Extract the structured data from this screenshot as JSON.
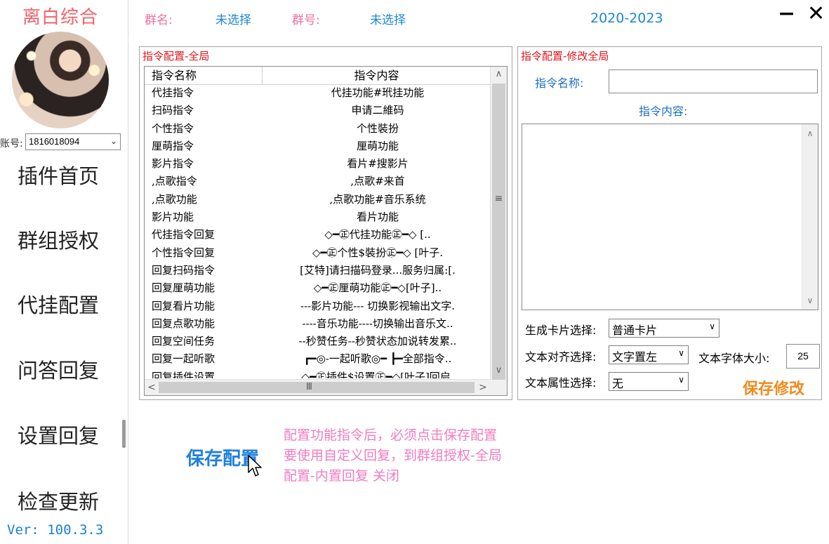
{
  "sidebar": {
    "title": "离白综合",
    "account_label": "账号:",
    "account_value": "1816018094",
    "nav": [
      "插件首页",
      "群组授权",
      "代挂配置",
      "问答回复",
      "设置回复",
      "检查更新"
    ],
    "version": "Ver:  100.3.3"
  },
  "header": {
    "group_name_label": "群名:",
    "group_name_value": "未选择",
    "group_id_label": "群号:",
    "group_id_value": "未选择",
    "year_range": "2020-2023",
    "minimize": "−",
    "close": "✕"
  },
  "command_panel": {
    "title": "指令配置-全局",
    "columns": [
      "指令名称",
      "指令内容"
    ],
    "rows": [
      {
        "name": "代挂指令",
        "content": "代挂功能#玳挂功能"
      },
      {
        "name": "扫码指令",
        "content": "申请二維码"
      },
      {
        "name": "个性指令",
        "content": "个性裝扮"
      },
      {
        "name": "厘萌指令",
        "content": "厘萌功能"
      },
      {
        "name": "影片指令",
        "content": "看片#搜影片"
      },
      {
        "name": ",点歌指令",
        "content": ",点歌#来首"
      },
      {
        "name": ",点歌功能",
        "content": ",点歌功能#音乐系统"
      },
      {
        "name": "影片功能",
        "content": "看片功能"
      },
      {
        "name": "代挂指令回复",
        "content": "◇━㊣代挂功能㊣━◇      [.."
      },
      {
        "name": "个性指令回复",
        "content": "◇━㊣个性$裝扮㊣━◇ [叶子."
      },
      {
        "name": "回复扫码指令",
        "content": "[艾特]请扫描码登录...服务归属:[."
      },
      {
        "name": "回复厘萌功能",
        "content": "◇━㊣厘萌功能㊣━◇[叶子].."
      },
      {
        "name": "回复看片功能",
        "content": "---影片功能--- 切换影视输出文字."
      },
      {
        "name": "回复点歌功能",
        "content": "----音乐功能----切换输出音乐文.."
      },
      {
        "name": "回复空间任务",
        "content": "--秒赞任务--秒赞状态加说转发累.."
      },
      {
        "name": "回复一起听歌",
        "content": "┏━◎-一起听歌◎━ ┣━全部指令.."
      },
      {
        "name": "回复插件设置",
        "content": "◇━㊣插件$设置㊣━◇[叶子]回启."
      }
    ]
  },
  "edit_panel": {
    "title": "指令配置-修改全局",
    "name_label": "指令名称:",
    "content_label": "指令内容:",
    "card_label": "生成卡片选择:",
    "card_value": "普通卡片",
    "align_label": "文本对齐选择:",
    "align_value": "文字置左",
    "font_size_label": "文本字体大小:",
    "font_size_value": "25",
    "attr_label": "文本属性选择:",
    "attr_value": "无",
    "save_button": "保存修改"
  },
  "bottom": {
    "save_config": "保存配置",
    "notice": [
      "配置功能指令后，必须点击保存配置",
      "要使用自定义回复，到群组授权-全局",
      "配置-内置回复 关闭"
    ]
  },
  "colors": {
    "title_red": "#f0626a",
    "accent_blue": "#1a86d8",
    "panel_title_red": "#e0141c",
    "save_orange": "#f08a1c",
    "notice_pink": "#f07cc0"
  }
}
